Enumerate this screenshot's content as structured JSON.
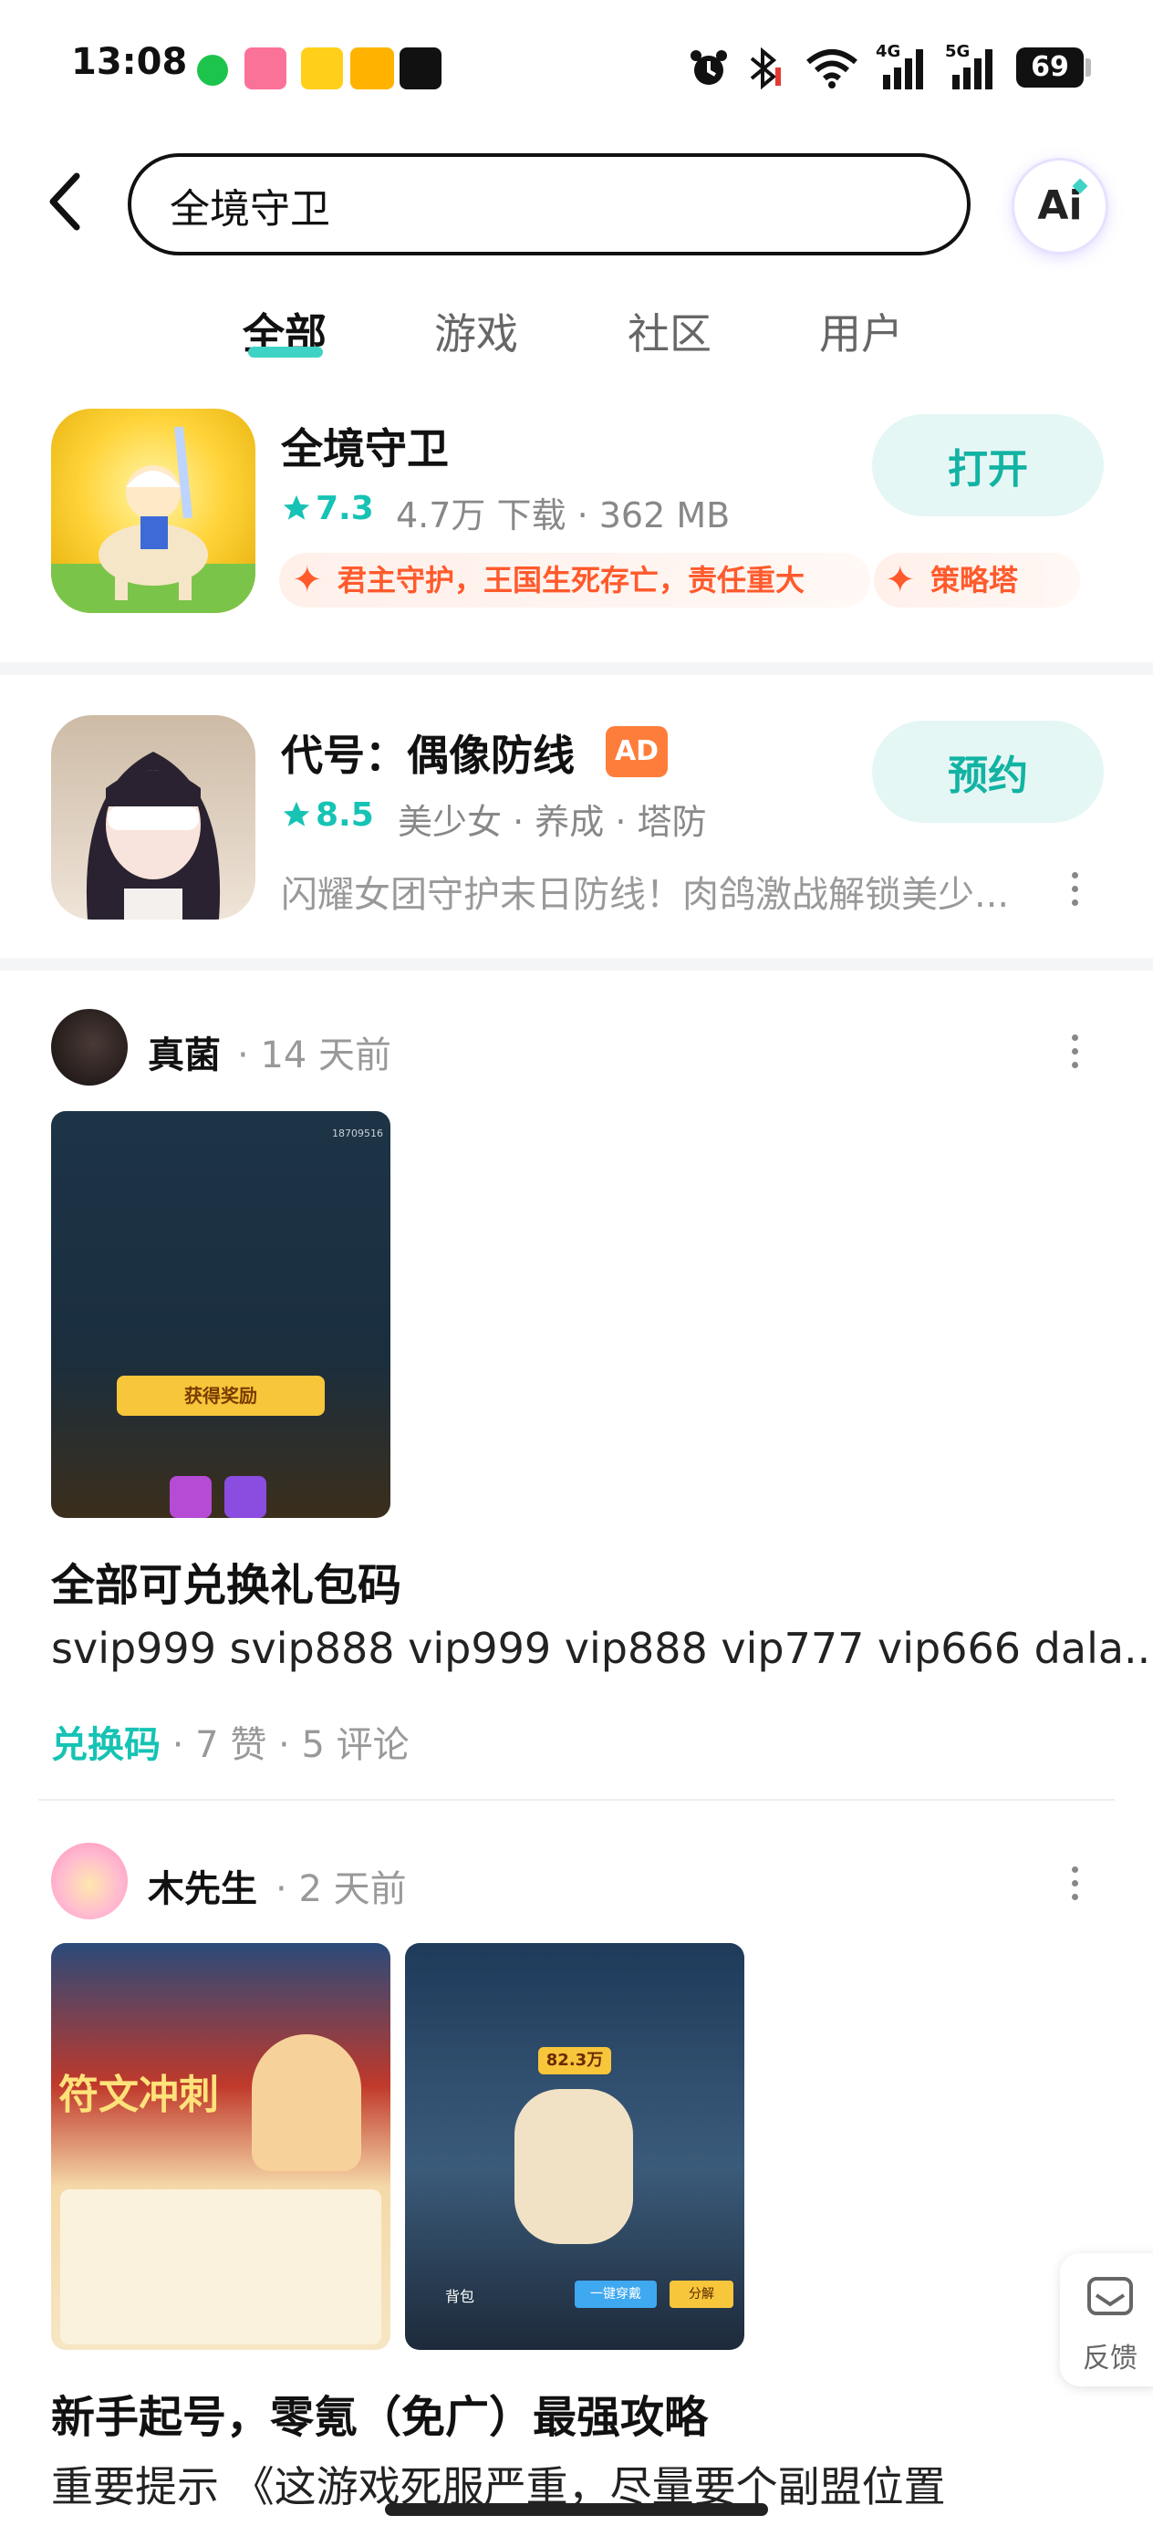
{
  "status_bar": {
    "time": "13:08",
    "battery": "69",
    "network_4g": "4G",
    "network_5g": "5G"
  },
  "search": {
    "value": "全境守卫",
    "ai_label": "Ai"
  },
  "tabs": [
    {
      "label": "全部",
      "active": true
    },
    {
      "label": "游戏",
      "active": false
    },
    {
      "label": "社区",
      "active": false
    },
    {
      "label": "用户",
      "active": false
    }
  ],
  "apps": [
    {
      "title": "全境守卫",
      "rating": "7.3",
      "meta": "4.7万 下载 · 362 MB",
      "button": "打开",
      "tags": [
        "君主守护，王国生死存亡，责任重大",
        "策略塔"
      ]
    },
    {
      "title": "代号：偶像防线",
      "ad": "AD",
      "rating": "8.5",
      "meta": "美少女 · 养成 · 塔防",
      "button": "预约",
      "description": "闪耀女团守护末日防线！肉鸽激战解锁美少..."
    }
  ],
  "posts": [
    {
      "author": "真菌",
      "time": "14 天前",
      "image_texts": [
        "18709516",
        "获得奖励"
      ],
      "title": "全部可兑换礼包码",
      "body": "svip999 svip888 vip999 vip888 vip777 vip666 dala...",
      "topic": "兑换码",
      "likes": "7 赞",
      "comments": "5 评论"
    },
    {
      "author": "木先生",
      "time": "2 天前",
      "image_texts": [
        "符文冲刺",
        "82.3万",
        "背包",
        "一键穿戴",
        "分解"
      ],
      "title": "新手起号，零氪（免广）最强攻略",
      "body": "重要提示 《这游戏死服严重，尽量要个副盟位置"
    }
  ],
  "feedback": {
    "label": "反馈"
  },
  "colors": {
    "accent": "#16c3b4",
    "ad": "#ff7d3a",
    "tag": "#ff5a2c"
  }
}
